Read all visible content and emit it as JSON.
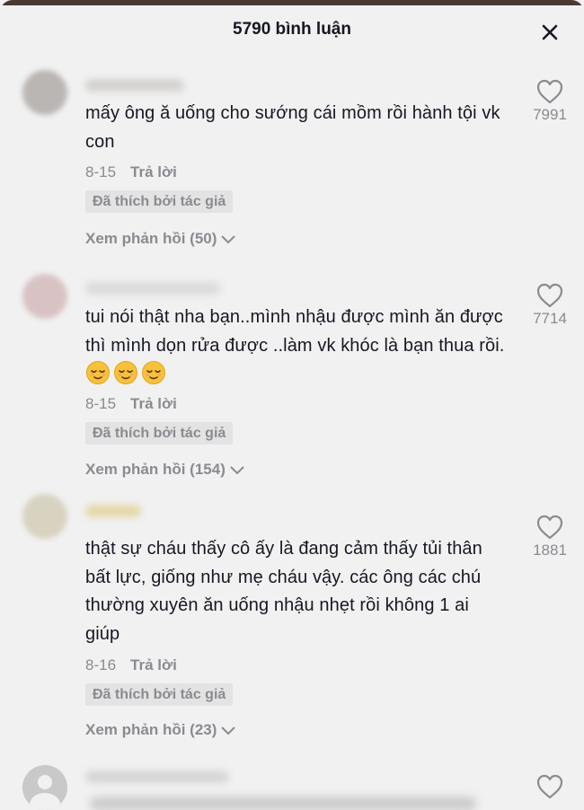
{
  "header": {
    "title": "5790 bình luận"
  },
  "comments": [
    {
      "text": "mấy ông ă uống cho sướng cái mồm rồi hành tội vk con",
      "date": "8-15",
      "reply": "Trả lời",
      "badge": "Đã thích bởi tác giả",
      "view_replies": "Xem phản hồi (50)",
      "likes": "7991"
    },
    {
      "text": "tui nói thật nha bạn..mình nhậu được mình ăn được thì mình dọn rửa được ..làm vk khóc là bạn thua rồi.",
      "emojis": [
        "relieved-face",
        "relieved-face",
        "relieved-face"
      ],
      "date": "8-15",
      "reply": "Trả lời",
      "badge": "Đã thích bởi tác giả",
      "view_replies": "Xem phản hồi (154)",
      "likes": "7714"
    },
    {
      "text": "thật sự cháu thấy cô ấy là đang cảm thấy tủi thân bất lực, giống như mẹ cháu vậy. các ông các chú thường xuyên ăn uống nhậu nhẹt rồi không 1 ai giúp",
      "date": "8-16",
      "reply": "Trả lời",
      "badge": "Đã thích bởi tác giả",
      "view_replies": "Xem phản hồi (23)",
      "likes": "1881"
    }
  ],
  "icons": {
    "close": "close-icon",
    "like": "heart-outline-icon",
    "chevron": "chevron-down-icon",
    "avatar": "default-avatar-icon"
  },
  "colors": {
    "background": "#f1f1f1",
    "text": "#161823",
    "muted": "#8a8b91",
    "badge_bg": "#e3e3e3"
  }
}
